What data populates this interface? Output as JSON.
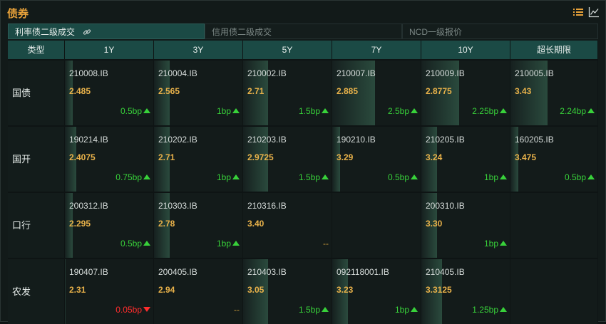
{
  "header": {
    "title": "债券",
    "list_icon": "list-icon",
    "chart_icon": "line-chart-icon"
  },
  "tabs": [
    {
      "label": "利率债二级成交",
      "active": true,
      "icon": "link-icon"
    },
    {
      "label": "信用债二级成交",
      "active": false
    },
    {
      "label": "NCD一级报价",
      "active": false
    }
  ],
  "columns": [
    "类型",
    "1Y",
    "3Y",
    "5Y",
    "7Y",
    "10Y",
    "超长期限"
  ],
  "rows": [
    {
      "label": "国债",
      "cells": [
        {
          "code": "210008.IB",
          "yield": "2.485",
          "chg": "0.5bp",
          "dir": "up",
          "bar": 0.09
        },
        {
          "code": "210004.IB",
          "yield": "2.565",
          "chg": "1bp",
          "dir": "up",
          "bar": 0.18
        },
        {
          "code": "210002.IB",
          "yield": "2.71",
          "chg": "1.5bp",
          "dir": "up",
          "bar": 0.28
        },
        {
          "code": "210007.IB",
          "yield": "2.885",
          "chg": "2.5bp",
          "dir": "up",
          "bar": 0.48
        },
        {
          "code": "210009.IB",
          "yield": "2.8775",
          "chg": "2.25bp",
          "dir": "up",
          "bar": 0.43
        },
        {
          "code": "210005.IB",
          "yield": "3.43",
          "chg": "2.24bp",
          "dir": "up",
          "bar": 0.43
        }
      ]
    },
    {
      "label": "国开",
      "cells": [
        {
          "code": "190214.IB",
          "yield": "2.4075",
          "chg": "0.75bp",
          "dir": "up",
          "bar": 0.13
        },
        {
          "code": "210202.IB",
          "yield": "2.71",
          "chg": "1bp",
          "dir": "up",
          "bar": 0.18
        },
        {
          "code": "210203.IB",
          "yield": "2.9725",
          "chg": "1.5bp",
          "dir": "up",
          "bar": 0.28
        },
        {
          "code": "190210.IB",
          "yield": "3.29",
          "chg": "0.5bp",
          "dir": "up",
          "bar": 0.09
        },
        {
          "code": "210205.IB",
          "yield": "3.24",
          "chg": "1bp",
          "dir": "up",
          "bar": 0.18
        },
        {
          "code": "160205.IB",
          "yield": "3.475",
          "chg": "0.5bp",
          "dir": "up",
          "bar": 0.09
        }
      ]
    },
    {
      "label": "口行",
      "cells": [
        {
          "code": "200312.IB",
          "yield": "2.295",
          "chg": "0.5bp",
          "dir": "up",
          "bar": 0.09
        },
        {
          "code": "210303.IB",
          "yield": "2.78",
          "chg": "1bp",
          "dir": "up",
          "bar": 0.18
        },
        {
          "code": "210316.IB",
          "yield": "3.40",
          "chg": "--",
          "dir": "flat",
          "bar": 0
        },
        null,
        {
          "code": "200310.IB",
          "yield": "3.30",
          "chg": "1bp",
          "dir": "up",
          "bar": 0.18
        },
        null
      ]
    },
    {
      "label": "农发",
      "cells": [
        {
          "code": "190407.IB",
          "yield": "2.31",
          "chg": "0.05bp",
          "dir": "down",
          "bar": 0.01
        },
        {
          "code": "200405.IB",
          "yield": "2.94",
          "chg": "--",
          "dir": "flat",
          "bar": 0
        },
        {
          "code": "210403.IB",
          "yield": "3.05",
          "chg": "1.5bp",
          "dir": "up",
          "bar": 0.28
        },
        {
          "code": "092118001.IB",
          "yield": "3.23",
          "chg": "1bp",
          "dir": "up",
          "bar": 0.18
        },
        {
          "code": "210405.IB",
          "yield": "3.3125",
          "chg": "1.25bp",
          "dir": "up",
          "bar": 0.23
        },
        null
      ]
    }
  ]
}
